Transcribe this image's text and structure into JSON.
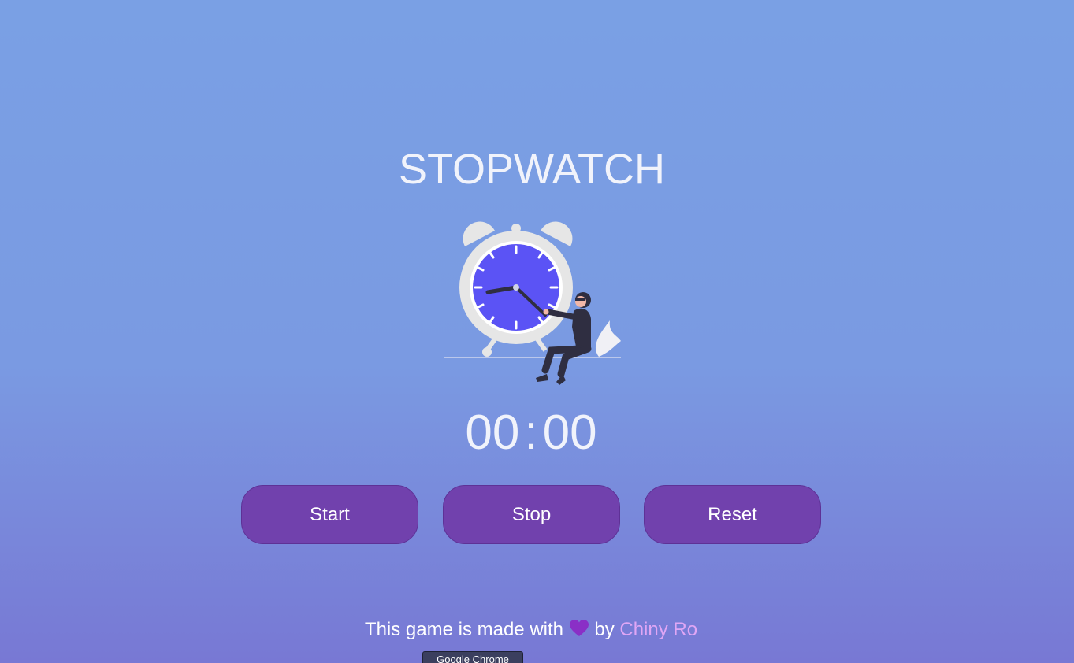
{
  "app": {
    "title": "STOPWATCH"
  },
  "timer": {
    "minutes": "00",
    "separator": ":",
    "seconds": "00"
  },
  "controls": {
    "start_label": "Start",
    "stop_label": "Stop",
    "reset_label": "Reset"
  },
  "footer": {
    "text_before": "This game is made with",
    "heart_icon": "heart-icon",
    "text_by": "by",
    "author": "Chiny Ro"
  },
  "tooltip": {
    "text": "Google Chrome"
  },
  "colors": {
    "background_top": "#7aa0e4",
    "background_bottom": "#7878d4",
    "button": "#7141ad",
    "clock_face": "#5b53f5",
    "author_link": "#e0a6f5",
    "heart": "#8a2fc6"
  }
}
